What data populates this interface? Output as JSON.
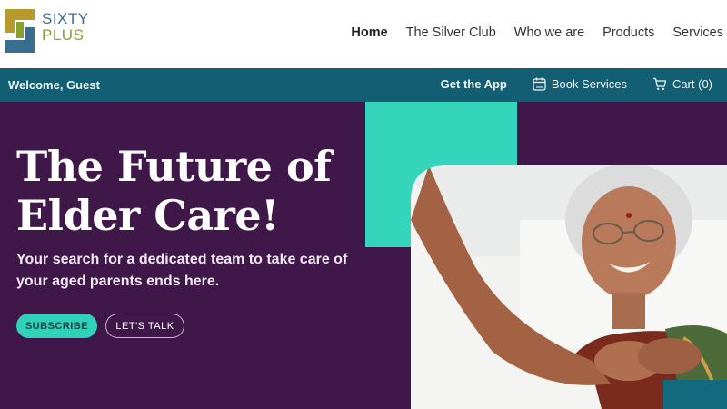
{
  "brand": {
    "line1": "SIXTY",
    "line2": "PLUS",
    "colors": {
      "blue": "#3a6e8f",
      "green": "#8aa12c",
      "gold": "#b79a2c"
    }
  },
  "nav": {
    "items": [
      {
        "label": "Home",
        "active": true
      },
      {
        "label": "The Silver Club"
      },
      {
        "label": "Who we are"
      },
      {
        "label": "Products"
      },
      {
        "label": "Services"
      }
    ]
  },
  "utility": {
    "welcome": "Welcome, Guest",
    "get_app": "Get the App",
    "book_services": "Book Services",
    "cart": "Cart (0)",
    "color": "#125e72"
  },
  "hero": {
    "title_line1": "The Future of",
    "title_line2": "Elder Care!",
    "subtitle": "Your search for a dedicated team to take care of your aged parents ends here.",
    "subscribe": "SUBSCRIBE",
    "lets_talk": "LET'S TALK",
    "bg_color": "#3f1749",
    "accent_color": "#34d5ba"
  }
}
